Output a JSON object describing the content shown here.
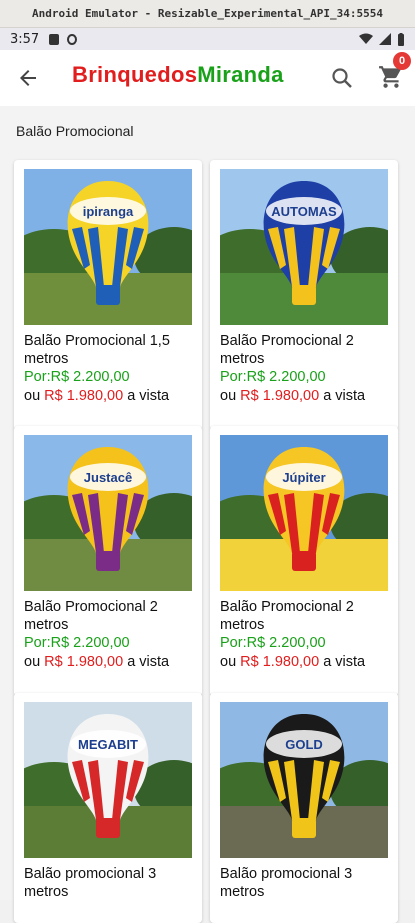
{
  "window": {
    "title": "Android Emulator - Resizable_Experimental_API_34:5554"
  },
  "status_bar": {
    "time": "3:57"
  },
  "app_bar": {
    "brand_part1": "Brinquedos",
    "brand_part2": "Miranda",
    "cart_count": "0",
    "colors": {
      "brand_red": "#e11d1d",
      "brand_green": "#1aa11a",
      "badge": "#e53935"
    }
  },
  "section": {
    "title": "Balão Promocional"
  },
  "products": [
    {
      "name": "Balão Promocional 1,5 metros",
      "price_label": "Por:",
      "price": "R$ 2.200,00",
      "prefix": "ou",
      "discount_price": "R$ 1.980,00",
      "suffix": "a vista",
      "logo_text": "ipiranga",
      "balloon_color": "#f5d327",
      "stripe_color": "#1f5fb8"
    },
    {
      "name": "Balão Promocional 2 metros",
      "price_label": "Por:",
      "price": "R$ 2.200,00",
      "prefix": "ou",
      "discount_price": "R$ 1.980,00",
      "suffix": "a vista",
      "logo_text": "AUTOMAS",
      "balloon_color": "#1e3fa6",
      "stripe_color": "#f3c21c"
    },
    {
      "name": "Balão Promocional 2 metros",
      "price_label": "Por:",
      "price": "R$ 2.200,00",
      "prefix": "ou",
      "discount_price": "R$ 1.980,00",
      "suffix": "a vista",
      "logo_text": "Justacê",
      "balloon_color": "#f4c21b",
      "stripe_color": "#7a2c86"
    },
    {
      "name": "Balão Promocional 2 metros",
      "price_label": "Por:",
      "price": "R$ 2.200,00",
      "prefix": "ou",
      "discount_price": "R$ 1.980,00",
      "suffix": "a vista",
      "logo_text": "Júpiter",
      "balloon_color": "#f5c624",
      "stripe_color": "#d9221f"
    },
    {
      "name": "Balão promocional 3 metros",
      "logo_text": "MEGABIT",
      "balloon_color": "#f4f4f4",
      "stripe_color": "#d62828"
    },
    {
      "name": "Balão promocional 3 metros",
      "logo_text": "GOLD",
      "balloon_color": "#1a1a1a",
      "stripe_color": "#f0c419"
    }
  ]
}
